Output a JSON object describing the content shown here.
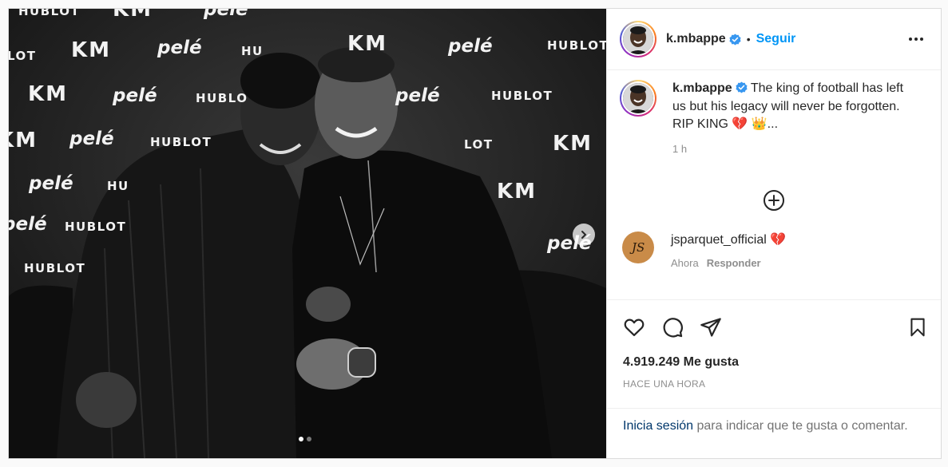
{
  "post": {
    "username": "k.mbappe",
    "separator": "•",
    "follow_label": "Seguir",
    "more_icon": "more-horizontal-icon"
  },
  "photo": {
    "backdrop_logos": {
      "hublot": "HUBLOT",
      "km": "KM",
      "pele": "pelé",
      "hublot_partial_1": "HUBLOT",
      "hublot_partial_2": "HUBLO",
      "hublot_partial_3": "HUBLOT",
      "hublot_partial_4": "HU",
      "lot_partial": "LOT",
      "lot_partial_2": "LOT",
      "hublot_top": "HUBLOT",
      "hublot_top2": "HU",
      "km_top": "KM",
      "pele_top": "pelé"
    },
    "carousel": {
      "total": 2,
      "active": 1
    }
  },
  "caption": {
    "username": "k.mbappe",
    "text_line1": "The king of football has left us but his legacy will never be forgotten.",
    "text_line2": "RIP KING 💔 👑...",
    "time": "1 h"
  },
  "comments": [
    {
      "username": "jsparquet_official",
      "text": "💔",
      "time": "Ahora",
      "reply_label": "Responder"
    }
  ],
  "actions": {
    "like_icon": "heart-icon",
    "comment_icon": "comment-icon",
    "share_icon": "paper-plane-icon",
    "save_icon": "bookmark-icon"
  },
  "likes": {
    "count": "4.919.249",
    "label": "Me gusta"
  },
  "timestamp": "HACE UNA HORA",
  "login_prompt": {
    "link": "Inicia sesión",
    "text": " para indicar que te gusta o comentar."
  },
  "colors": {
    "accent": "#0095f6",
    "text": "#262626",
    "muted": "#8e8e8e",
    "border": "#dbdbdb"
  }
}
